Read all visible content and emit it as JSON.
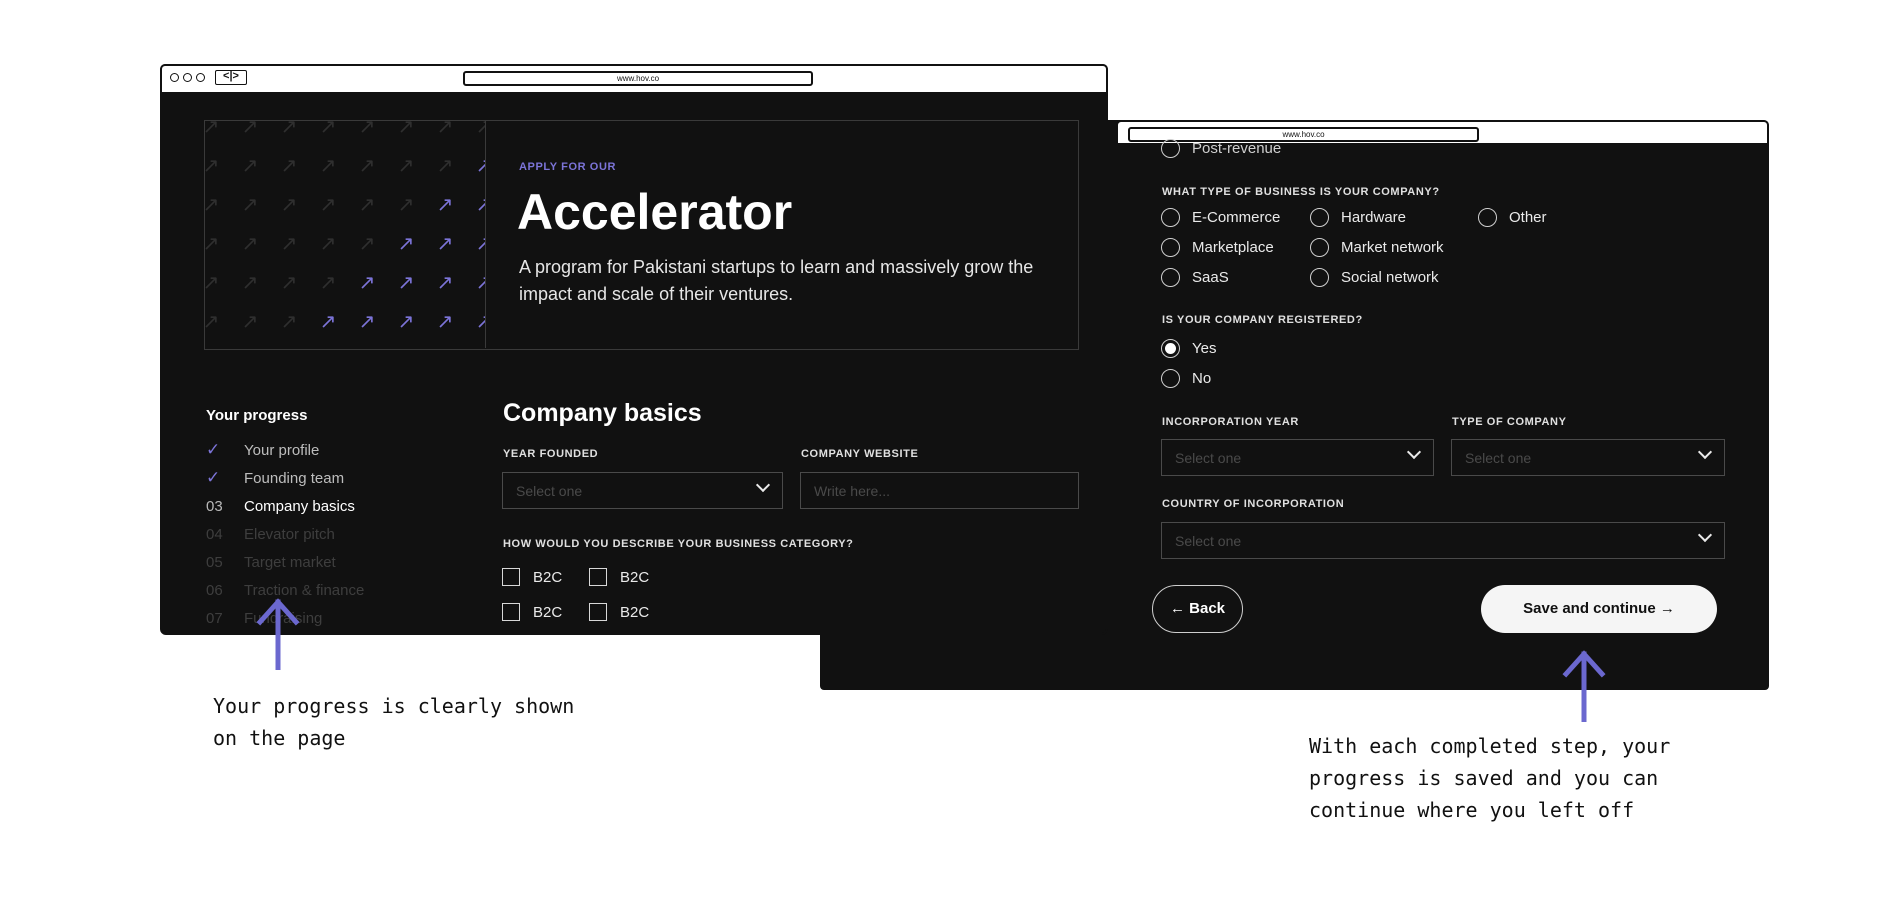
{
  "left_window": {
    "url": "www.hov.co",
    "nav_buttons": "<|>",
    "hero": {
      "kicker": "APPLY FOR OUR",
      "title": "Accelerator",
      "description": "A program for Pakistani startups to learn and massively grow the impact and scale of their ventures."
    },
    "progress": {
      "title": "Your progress",
      "steps": [
        {
          "num": "",
          "label": "Your profile",
          "state": "done"
        },
        {
          "num": "",
          "label": "Founding team",
          "state": "done"
        },
        {
          "num": "03",
          "label": "Company basics",
          "state": "current"
        },
        {
          "num": "04",
          "label": "Elevator pitch",
          "state": "future"
        },
        {
          "num": "05",
          "label": "Target market",
          "state": "future"
        },
        {
          "num": "06",
          "label": "Traction & finance",
          "state": "future"
        },
        {
          "num": "07",
          "label": "Fundraising",
          "state": "future"
        }
      ]
    },
    "form": {
      "title": "Company basics",
      "year_founded_label": "YEAR FOUNDED",
      "year_founded_placeholder": "Select one",
      "website_label": "COMPANY WEBSITE",
      "website_placeholder": "Write here...",
      "category_label": "HOW WOULD YOU DESCRIBE YOUR BUSINESS CATEGORY?",
      "categories": [
        "B2C",
        "B2C",
        "B2C",
        "B2C"
      ]
    }
  },
  "right_window": {
    "url": "www.hov.co",
    "revenue_partial_option": "Post-revenue",
    "business_type_label": "WHAT TYPE OF BUSINESS IS YOUR COMPANY?",
    "business_types": [
      "E-Commerce",
      "Hardware",
      "Other",
      "Marketplace",
      "Market network",
      "SaaS",
      "Social network"
    ],
    "registered_label": "IS YOUR COMPANY REGISTERED?",
    "registered_options": [
      "Yes",
      "No"
    ],
    "registered_selected": "Yes",
    "incorporation_year_label": "INCORPORATION YEAR",
    "incorporation_year_placeholder": "Select one",
    "company_type_label": "TYPE OF COMPANY",
    "company_type_placeholder": "Select one",
    "country_label": "COUNTRY OF INCORPORATION",
    "country_placeholder": "Select one",
    "back_label": "← Back",
    "save_label": "Save and continue →"
  },
  "annotations": {
    "left_line1": "Your progress is clearly shown",
    "left_line2": "on the page",
    "right_line1": "With each completed step, your",
    "right_line2": "progress is saved and you can",
    "right_line3": "continue where you left off"
  },
  "colors": {
    "accent": "#7c74d8",
    "window_bg": "#111111",
    "page_bg": "#ffffff"
  }
}
